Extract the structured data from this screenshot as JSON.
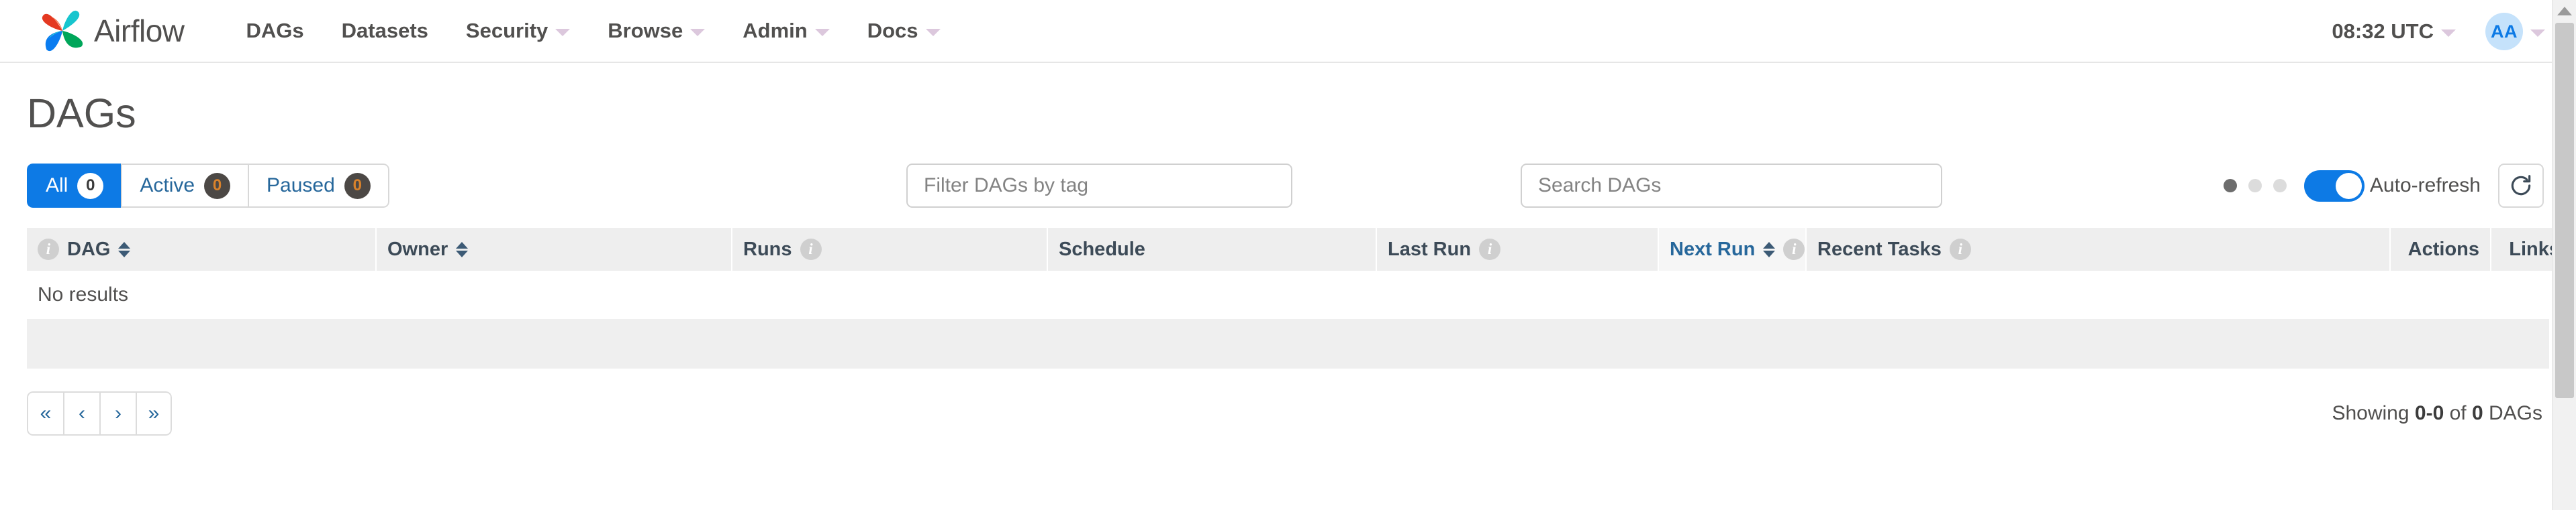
{
  "navbar": {
    "brand": {
      "name": "Airflow",
      "logo_icon": "airflow-pinwheel-icon"
    },
    "items": [
      {
        "label": "DAGs",
        "has_caret": false
      },
      {
        "label": "Datasets",
        "has_caret": false
      },
      {
        "label": "Security",
        "has_caret": true
      },
      {
        "label": "Browse",
        "has_caret": true
      },
      {
        "label": "Admin",
        "has_caret": true
      },
      {
        "label": "Docs",
        "has_caret": true
      }
    ],
    "clock": "08:32 UTC",
    "avatar_initials": "AA"
  },
  "page": {
    "title": "DAGs"
  },
  "filters": {
    "pills": [
      {
        "label": "All",
        "count": "0",
        "active": true
      },
      {
        "label": "Active",
        "count": "0",
        "active": false
      },
      {
        "label": "Paused",
        "count": "0",
        "active": false
      }
    ],
    "tag_filter_placeholder": "Filter DAGs by tag",
    "search_placeholder": "Search DAGs",
    "tag_filter_value": "",
    "search_value": ""
  },
  "auto_refresh": {
    "label": "Auto-refresh",
    "enabled": true,
    "refresh_icon": "refresh-icon"
  },
  "table": {
    "columns": [
      {
        "label": "DAG",
        "info": true,
        "sortable": true,
        "blue": false,
        "align": "left"
      },
      {
        "label": "Owner",
        "info": false,
        "sortable": true,
        "blue": false,
        "align": "left"
      },
      {
        "label": "Runs",
        "info": true,
        "sortable": false,
        "blue": false,
        "align": "left"
      },
      {
        "label": "Schedule",
        "info": false,
        "sortable": false,
        "blue": false,
        "align": "left"
      },
      {
        "label": "Last Run",
        "info": true,
        "sortable": false,
        "blue": false,
        "align": "left"
      },
      {
        "label": "Next Run",
        "info": true,
        "sortable": true,
        "blue": true,
        "align": "left"
      },
      {
        "label": "Recent Tasks",
        "info": true,
        "sortable": false,
        "blue": false,
        "align": "left"
      },
      {
        "label": "Actions",
        "info": false,
        "sortable": false,
        "blue": false,
        "align": "right"
      },
      {
        "label": "Links",
        "info": false,
        "sortable": false,
        "blue": false,
        "align": "right"
      }
    ],
    "empty_message": "No results",
    "rows": []
  },
  "pagination": {
    "buttons": [
      {
        "glyph": "«",
        "name": "first-page"
      },
      {
        "glyph": "‹",
        "name": "previous-page"
      },
      {
        "glyph": "›",
        "name": "next-page"
      },
      {
        "glyph": "»",
        "name": "last-page"
      }
    ],
    "showing_prefix": "Showing ",
    "showing_range": "0-0",
    "showing_middle": " of ",
    "showing_total": "0",
    "showing_suffix": " DAGs"
  },
  "colors": {
    "accent_blue": "#0d7ae5",
    "link_blue": "#26679b",
    "badge_dark": "#4c4845",
    "badge_orange": "#d9822b",
    "text": "#51504f",
    "header_bg": "#eeeeee"
  }
}
